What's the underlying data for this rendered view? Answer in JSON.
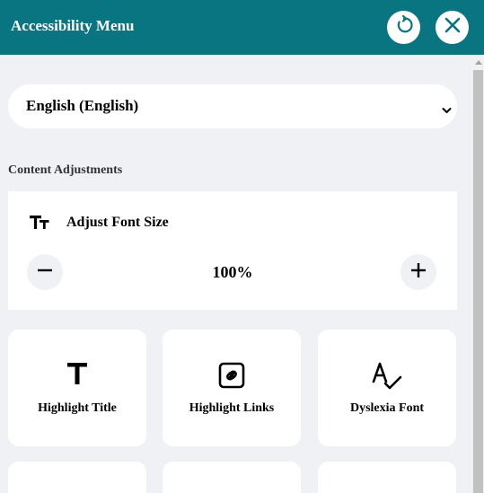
{
  "header": {
    "title": "Accessibility Menu",
    "accent_color": "#097581",
    "reset_icon": "reset-icon",
    "close_icon": "close-icon"
  },
  "language": {
    "selected": "English (English)"
  },
  "content_adjustments": {
    "label": "Content Adjustments",
    "font_size": {
      "label": "Adjust Font Size",
      "value": "100%",
      "icon": "font-size-icon",
      "decrease_icon": "minus-icon",
      "increase_icon": "plus-icon"
    },
    "tiles": [
      {
        "label": "Highlight Title",
        "icon": "title-icon"
      },
      {
        "label": "Highlight Links",
        "icon": "link-icon"
      },
      {
        "label": "Dyslexia Font",
        "icon": "spell-check-icon"
      }
    ]
  }
}
